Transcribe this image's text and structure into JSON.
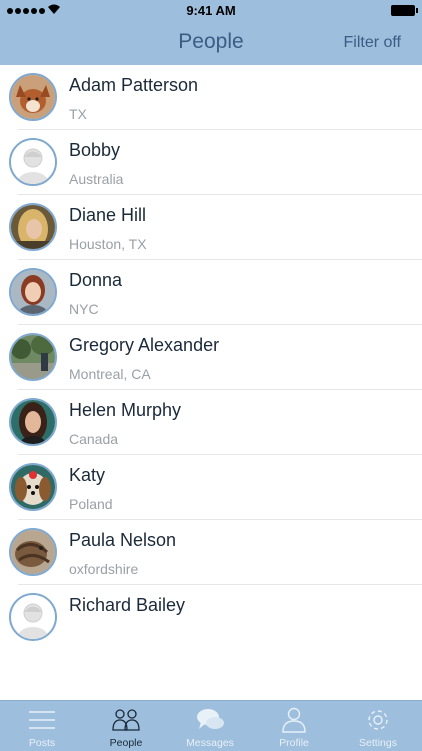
{
  "status": {
    "time": "9:41 AM"
  },
  "nav": {
    "title": "People",
    "filter_label": "Filter off"
  },
  "people": [
    {
      "name": "Adam Patterson",
      "location": "TX",
      "avatar": "dog-photo"
    },
    {
      "name": "Bobby",
      "location": "Australia",
      "avatar": "default-avatar"
    },
    {
      "name": "Diane Hill",
      "location": "Houston, TX",
      "avatar": "photo-blonde"
    },
    {
      "name": "Donna",
      "location": "NYC",
      "avatar": "photo-redhead"
    },
    {
      "name": "Gregory Alexander",
      "location": "Montreal, CA",
      "avatar": "photo-outdoors"
    },
    {
      "name": "Helen Murphy",
      "location": "Canada",
      "avatar": "photo-brunette"
    },
    {
      "name": "Katy",
      "location": "Poland",
      "avatar": "dog-photo"
    },
    {
      "name": "Paula Nelson",
      "location": "oxfordshire",
      "avatar": "cat-photo"
    },
    {
      "name": "Richard Bailey",
      "location": "",
      "avatar": "default-avatar"
    }
  ],
  "tabs": [
    {
      "label": "Posts",
      "icon": "menu-lines-icon"
    },
    {
      "label": "People",
      "icon": "people-icon"
    },
    {
      "label": "Messages",
      "icon": "chat-bubbles-icon"
    },
    {
      "label": "Profile",
      "icon": "person-icon"
    },
    {
      "label": "Settings",
      "icon": "gear-icon"
    }
  ],
  "colors": {
    "bar": "#9dbedc",
    "title": "#3c5c84",
    "avatar_ring": "#7fa9d0"
  }
}
